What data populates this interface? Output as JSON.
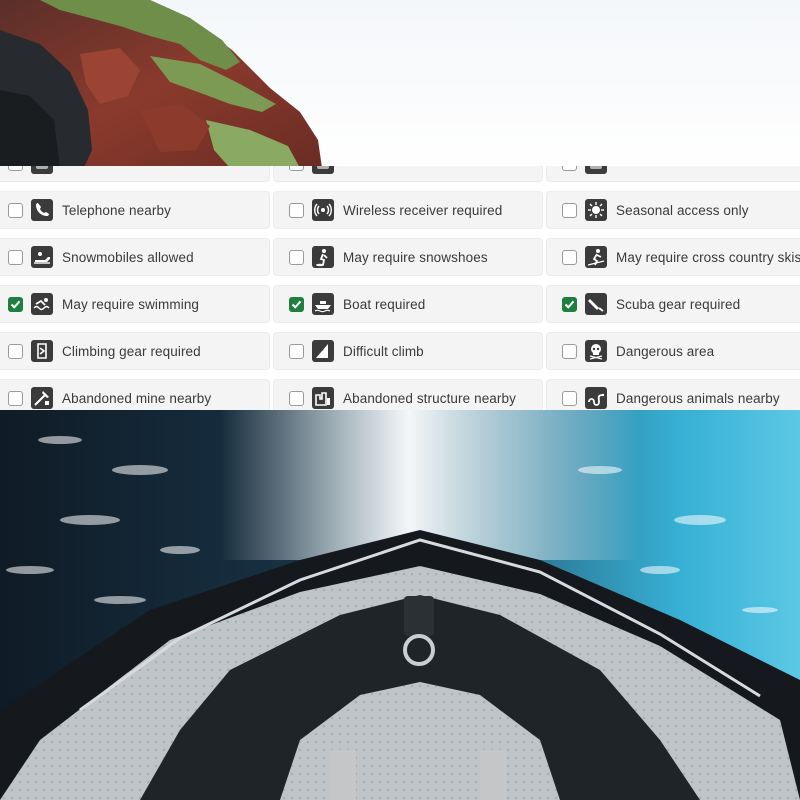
{
  "attributes": [
    {
      "label": "",
      "checked": false,
      "icon": "partial-icon"
    },
    {
      "label": "",
      "checked": false,
      "icon": "partial-icon"
    },
    {
      "label": "",
      "checked": false,
      "icon": "partial-icon"
    },
    {
      "label": "Telephone nearby",
      "checked": false,
      "icon": "telephone-icon"
    },
    {
      "label": "Wireless receiver required",
      "checked": false,
      "icon": "wireless-icon"
    },
    {
      "label": "Seasonal access only",
      "checked": false,
      "icon": "seasonal-icon"
    },
    {
      "label": "Snowmobiles allowed",
      "checked": false,
      "icon": "snowmobile-icon"
    },
    {
      "label": "May require snowshoes",
      "checked": false,
      "icon": "snowshoes-icon"
    },
    {
      "label": "May require cross country skis",
      "checked": false,
      "icon": "cross-country-skis-icon"
    },
    {
      "label": "May require swimming",
      "checked": true,
      "icon": "swimming-icon"
    },
    {
      "label": "Boat required",
      "checked": true,
      "icon": "boat-icon"
    },
    {
      "label": "Scuba gear required",
      "checked": true,
      "icon": "scuba-icon"
    },
    {
      "label": "Climbing gear required",
      "checked": false,
      "icon": "climbing-gear-icon"
    },
    {
      "label": "Difficult climb",
      "checked": false,
      "icon": "difficult-climb-icon"
    },
    {
      "label": "Dangerous area",
      "checked": false,
      "icon": "skull-icon"
    },
    {
      "label": "Abandoned mine nearby",
      "checked": false,
      "icon": "mine-icon"
    },
    {
      "label": "Abandoned structure nearby",
      "checked": false,
      "icon": "structure-icon"
    },
    {
      "label": "Dangerous animals nearby",
      "checked": false,
      "icon": "snake-icon"
    }
  ],
  "colors": {
    "checked": "#1e7f3e",
    "cell_background": "#f4f4f4",
    "icon_background": "#3b3b3b",
    "label_text": "#3a3a3a"
  }
}
